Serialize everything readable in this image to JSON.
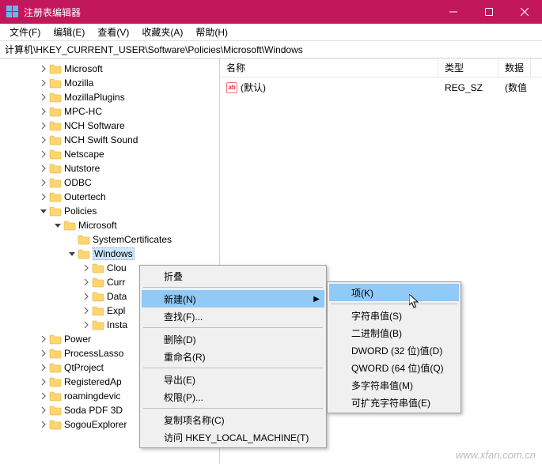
{
  "window": {
    "title": "注册表编辑器"
  },
  "menubar": [
    "文件(F)",
    "编辑(E)",
    "查看(V)",
    "收藏夹(A)",
    "帮助(H)"
  ],
  "address": "计算机\\HKEY_CURRENT_USER\\Software\\Policies\\Microsoft\\Windows",
  "columns": {
    "name": "名称",
    "type": "类型",
    "data": "数据"
  },
  "values": [
    {
      "name": "(默认)",
      "type": "REG_SZ",
      "data": "(数值"
    }
  ],
  "col_widths": {
    "name": 276,
    "type": 76
  },
  "tree": [
    {
      "indent": 48,
      "exp": ">",
      "label": "Microsoft"
    },
    {
      "indent": 48,
      "exp": ">",
      "label": "Mozilla"
    },
    {
      "indent": 48,
      "exp": ">",
      "label": "MozillaPlugins"
    },
    {
      "indent": 48,
      "exp": ">",
      "label": "MPC-HC"
    },
    {
      "indent": 48,
      "exp": ">",
      "label": "NCH Software"
    },
    {
      "indent": 48,
      "exp": ">",
      "label": "NCH Swift Sound"
    },
    {
      "indent": 48,
      "exp": ">",
      "label": "Netscape"
    },
    {
      "indent": 48,
      "exp": ">",
      "label": "Nutstore"
    },
    {
      "indent": 48,
      "exp": ">",
      "label": "ODBC"
    },
    {
      "indent": 48,
      "exp": ">",
      "label": "Outertech"
    },
    {
      "indent": 48,
      "exp": "v",
      "label": "Policies"
    },
    {
      "indent": 66,
      "exp": "v",
      "label": "Microsoft"
    },
    {
      "indent": 84,
      "exp": "",
      "label": "SystemCertificates"
    },
    {
      "indent": 84,
      "exp": "v",
      "label": "Windows",
      "sel": true
    },
    {
      "indent": 102,
      "exp": ">",
      "label": "Clou"
    },
    {
      "indent": 102,
      "exp": ">",
      "label": "Curr"
    },
    {
      "indent": 102,
      "exp": ">",
      "label": "Data"
    },
    {
      "indent": 102,
      "exp": ">",
      "label": "Expl"
    },
    {
      "indent": 102,
      "exp": ">",
      "label": "Insta"
    },
    {
      "indent": 48,
      "exp": ">",
      "label": "Power"
    },
    {
      "indent": 48,
      "exp": ">",
      "label": "ProcessLasso"
    },
    {
      "indent": 48,
      "exp": ">",
      "label": "QtProject"
    },
    {
      "indent": 48,
      "exp": ">",
      "label": "RegisteredAp"
    },
    {
      "indent": 48,
      "exp": ">",
      "label": "roamingdevic"
    },
    {
      "indent": 48,
      "exp": ">",
      "label": "Soda PDF 3D"
    },
    {
      "indent": 48,
      "exp": ">",
      "label": "SogouExplorer"
    }
  ],
  "ctx1": [
    {
      "label": "折叠"
    },
    {
      "sep": true
    },
    {
      "label": "新建(N)",
      "sub": true,
      "hi": true
    },
    {
      "label": "查找(F)..."
    },
    {
      "sep": true
    },
    {
      "label": "删除(D)"
    },
    {
      "label": "重命名(R)"
    },
    {
      "sep": true
    },
    {
      "label": "导出(E)"
    },
    {
      "label": "权限(P)..."
    },
    {
      "sep": true
    },
    {
      "label": "复制项名称(C)"
    },
    {
      "label": "访问 HKEY_LOCAL_MACHINE(T)"
    }
  ],
  "ctx2": [
    {
      "label": "项(K)",
      "hi": true
    },
    {
      "sep": true
    },
    {
      "label": "字符串值(S)"
    },
    {
      "label": "二进制值(B)"
    },
    {
      "label": "DWORD (32 位)值(D)"
    },
    {
      "label": "QWORD (64 位)值(Q)"
    },
    {
      "label": "多字符串值(M)"
    },
    {
      "label": "可扩充字符串值(E)"
    }
  ],
  "watermark": "www.xfan.com.cn"
}
